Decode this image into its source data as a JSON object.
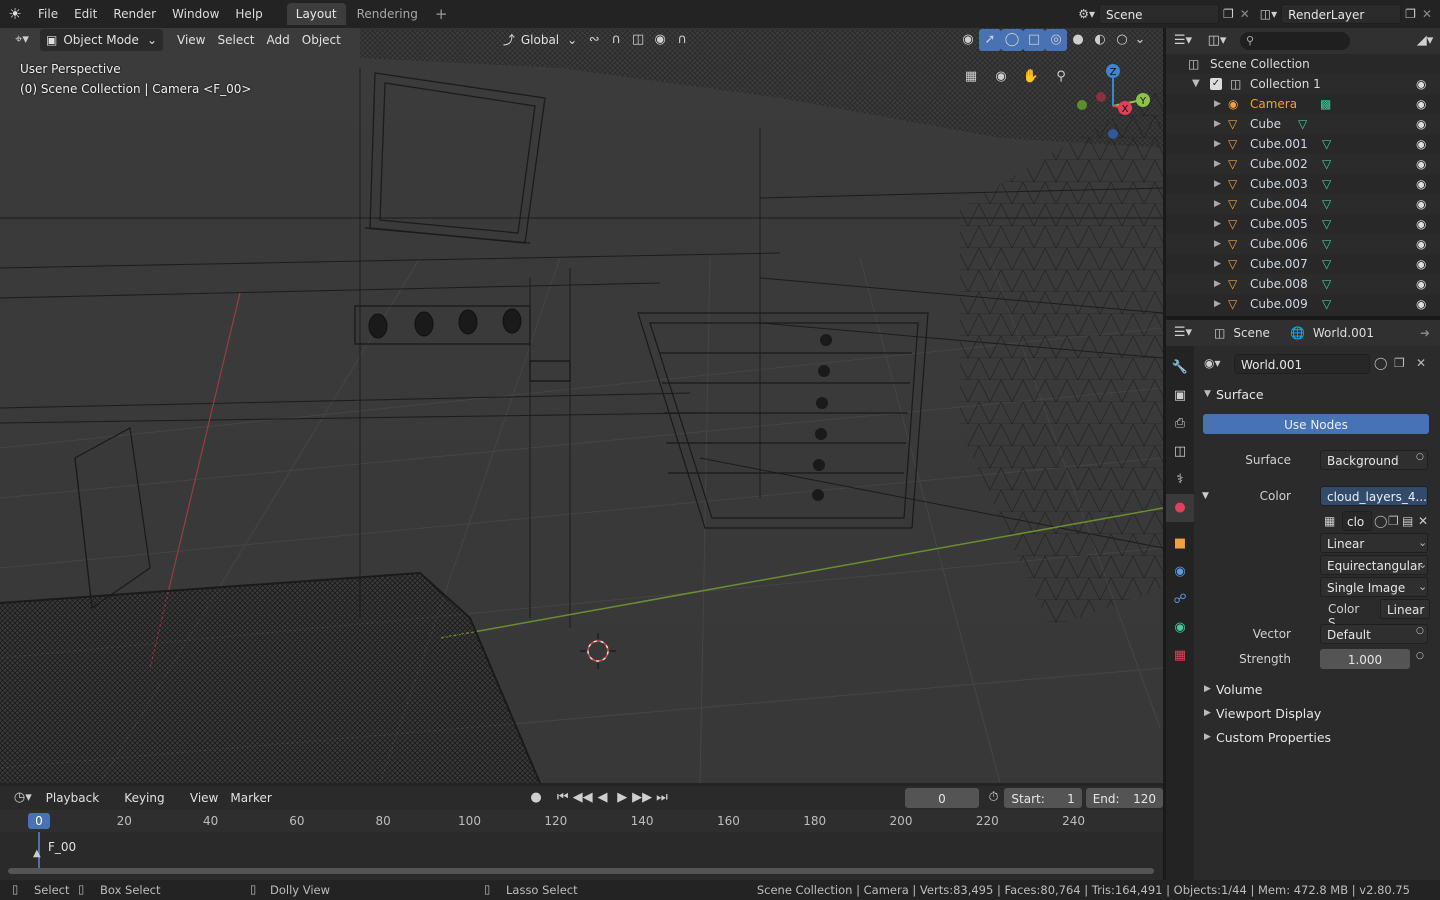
{
  "topbar": {
    "menus": [
      "File",
      "Edit",
      "Render",
      "Window",
      "Help"
    ],
    "tabs": [
      "Layout",
      "Rendering"
    ],
    "scene": "Scene",
    "render_layer": "RenderLayer"
  },
  "viewport": {
    "mode": "Object Mode",
    "menus": [
      "View",
      "Select",
      "Add",
      "Object"
    ],
    "orientation": "Global",
    "overlay_line1": "User Perspective",
    "overlay_line2": "(0) Scene Collection | Camera <F_00>",
    "gizmo_axes": [
      "Z",
      "Y",
      "X"
    ]
  },
  "outliner": {
    "root": "Scene Collection",
    "collection": "Collection 1",
    "items": [
      {
        "name": "Camera",
        "color": "#f0a040"
      },
      {
        "name": "Cube",
        "color": "#cfd8e4"
      },
      {
        "name": "Cube.001",
        "color": "#cfd8e4"
      },
      {
        "name": "Cube.002",
        "color": "#cfd8e4"
      },
      {
        "name": "Cube.003",
        "color": "#cfd8e4"
      },
      {
        "name": "Cube.004",
        "color": "#cfd8e4"
      },
      {
        "name": "Cube.005",
        "color": "#cfd8e4"
      },
      {
        "name": "Cube.006",
        "color": "#cfd8e4"
      },
      {
        "name": "Cube.007",
        "color": "#cfd8e4"
      },
      {
        "name": "Cube.008",
        "color": "#cfd8e4"
      },
      {
        "name": "Cube.009",
        "color": "#cfd8e4"
      }
    ]
  },
  "properties": {
    "header_scene": "Scene",
    "header_world": "World.001",
    "world_name": "World.001",
    "surface_section": "Surface",
    "use_nodes": "Use Nodes",
    "surface_label": "Surface",
    "surface_value": "Background",
    "color_label": "Color",
    "color_value": "cloud_layers_4...",
    "image_short": "clo",
    "interpolation": "Linear",
    "projection": "Equirectangular",
    "source": "Single Image",
    "color_space_label": "Color S..",
    "color_space_value": "Linear",
    "vector_label": "Vector",
    "vector_value": "Default",
    "strength_label": "Strength",
    "strength_value": "1.000",
    "sections": [
      "Volume",
      "Viewport Display",
      "Custom Properties"
    ]
  },
  "timeline": {
    "menus": [
      "Playback",
      "Keying",
      "View",
      "Marker"
    ],
    "current_frame": "0",
    "start_label": "Start:",
    "start_value": "1",
    "end_label": "End:",
    "end_value": "120",
    "ruler_marks": [
      "20",
      "40",
      "60",
      "80",
      "100",
      "120",
      "140",
      "160",
      "180",
      "200",
      "220",
      "240"
    ],
    "playhead": "0",
    "marker": "F_00"
  },
  "statusbar": {
    "select": "Select",
    "box_select": "Box Select",
    "dolly": "Dolly View",
    "lasso": "Lasso Select",
    "stats": "Scene Collection | Camera | Verts:83,495 | Faces:80,764 | Tris:164,491 | Objects:1/44 | Mem: 472.8 MB | v2.80.75"
  },
  "colors": {
    "accent": "#4772b3",
    "selected_blue": "#334a6b",
    "camera_orange": "#f0a040",
    "mesh_green": "#45c9a0",
    "axis_x": "#e0405a",
    "axis_y": "#8bc34a",
    "axis_z": "#3d82e0"
  }
}
